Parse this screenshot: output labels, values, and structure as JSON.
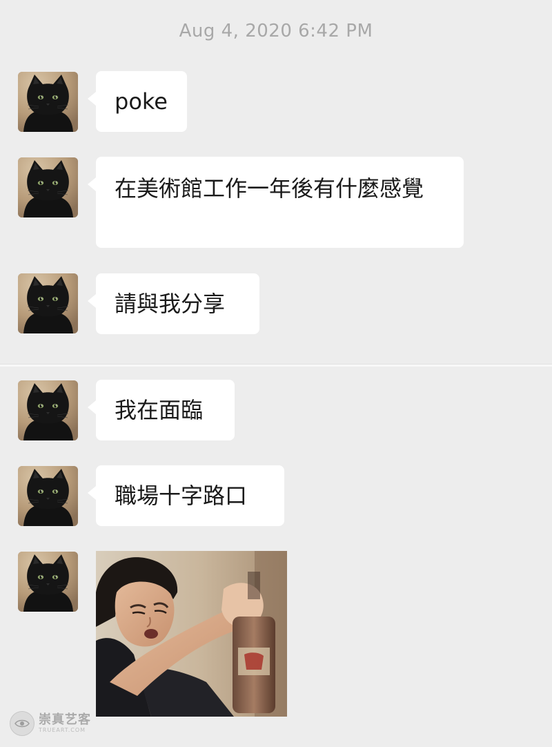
{
  "chat": {
    "timestamp": "Aug 4, 2020 6:42 PM",
    "messages": [
      {
        "sender": "cat-avatar",
        "type": "text",
        "text": "poke"
      },
      {
        "sender": "cat-avatar",
        "type": "text",
        "text": "在美術館工作一年後有什麼感覺"
      },
      {
        "sender": "cat-avatar",
        "type": "text",
        "text": "請與我分享"
      },
      {
        "sender": "cat-avatar",
        "type": "text",
        "text": "我在面臨"
      },
      {
        "sender": "cat-avatar",
        "type": "text",
        "text": "職場十字路口"
      },
      {
        "sender": "cat-avatar",
        "type": "image",
        "image_semantic": "meme-photo-child-reaching-for-bottle"
      }
    ]
  },
  "watermark": {
    "name": "崇真艺客",
    "subtitle": "TRUEART.COM",
    "icon": "eye-logo-icon"
  },
  "colors": {
    "background": "#ededed",
    "bubble": "#ffffff",
    "timestamp_text": "#a8a8a8",
    "message_text": "#1a1a1a"
  }
}
